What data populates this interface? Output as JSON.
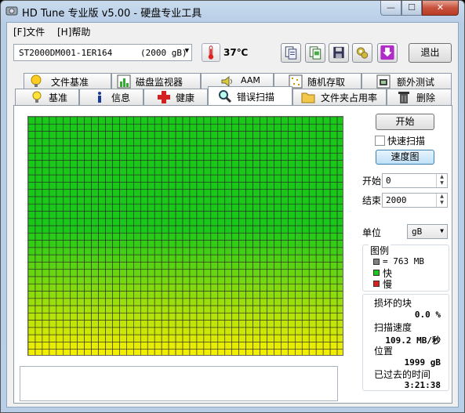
{
  "window": {
    "title": "HD Tune 专业版 v5.00 - 硬盘专业工具",
    "icon": "hd-tune-app-icon",
    "controls": {
      "minimize": "—",
      "maximize": "☐",
      "close": "✕"
    }
  },
  "menu": [
    {
      "label": "[F]文件"
    },
    {
      "label": "[H]帮助"
    }
  ],
  "toolbar": {
    "drive_model": "ST2000DM001-1ER164",
    "drive_size": "(2000 gB)",
    "temperature": "37℃",
    "exit_label": "退出",
    "tool_icons": [
      "copy-text-icon",
      "copy-screenshot-icon",
      "save-icon",
      "options-gear-icon",
      "download-arrow-icon"
    ]
  },
  "tabs_row1": [
    {
      "label": "文件基准",
      "icon": "file-benchmark-icon"
    },
    {
      "label": "磁盘监视器",
      "icon": "disk-monitor-icon"
    },
    {
      "label": "AAM",
      "icon": "speaker-icon"
    },
    {
      "label": "随机存取",
      "icon": "random-access-icon"
    },
    {
      "label": "额外测试",
      "icon": "extra-tests-icon"
    }
  ],
  "tabs_row2": [
    {
      "label": "基准",
      "icon": "lightbulb-icon"
    },
    {
      "label": "信息",
      "icon": "info-icon"
    },
    {
      "label": "健康",
      "icon": "health-cross-icon"
    },
    {
      "label": "错误扫描",
      "icon": "magnifier-icon",
      "active": true
    },
    {
      "label": "文件夹占用率",
      "icon": "folder-icon"
    },
    {
      "label": "删除",
      "icon": "trash-icon"
    }
  ],
  "scan": {
    "start_label": "开始",
    "quick_scan_label": "快速扫描",
    "quick_scan_checked": false,
    "speed_map_label": "速度图",
    "start_field_label": "开始",
    "start_value": "0",
    "end_field_label": "结束",
    "end_value": "2000",
    "unit_label": "单位",
    "unit_value": "gB",
    "legend_title": "图例",
    "legend_block": "= 763 MB",
    "legend_fast": "快",
    "legend_slow": "慢",
    "damaged_label": "损坏的块",
    "damaged_value": "0.0 %",
    "speed_label": "扫描速度",
    "speed_value": "109.2 MB/秒",
    "position_label": "位置",
    "position_value": "1999 gB",
    "elapsed_label": "已过去的时间",
    "elapsed_value": "3:21:38",
    "grid_columns": 45,
    "grid_rows": 33,
    "grid_colors": {
      "fast": "#19c819",
      "slow_yellow": "#ffff00",
      "damaged": "#e02020",
      "block_gray": "#808080"
    }
  }
}
